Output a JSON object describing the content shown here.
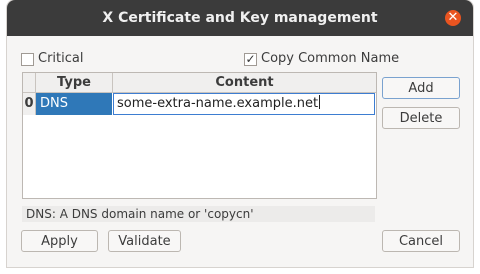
{
  "window": {
    "title": "X Certificate and Key management",
    "close_glyph": "✕"
  },
  "options": {
    "critical_label": "Critical",
    "critical_checked": false,
    "copy_cn_label": "Copy Common Name",
    "copy_cn_checked": true,
    "check_glyph": "✓"
  },
  "table": {
    "headers": {
      "type": "Type",
      "content": "Content"
    },
    "rows": [
      {
        "index": "0",
        "type": "DNS",
        "content": "some-extra-name.example.net"
      }
    ]
  },
  "status_text": "DNS: A DNS domain name or 'copycn'",
  "buttons": {
    "add": "Add",
    "delete": "Delete",
    "apply": "Apply",
    "validate": "Validate",
    "cancel": "Cancel"
  },
  "colors": {
    "titlebar": "#3b3b3b",
    "close": "#e95420",
    "selection": "#2f78b8"
  }
}
